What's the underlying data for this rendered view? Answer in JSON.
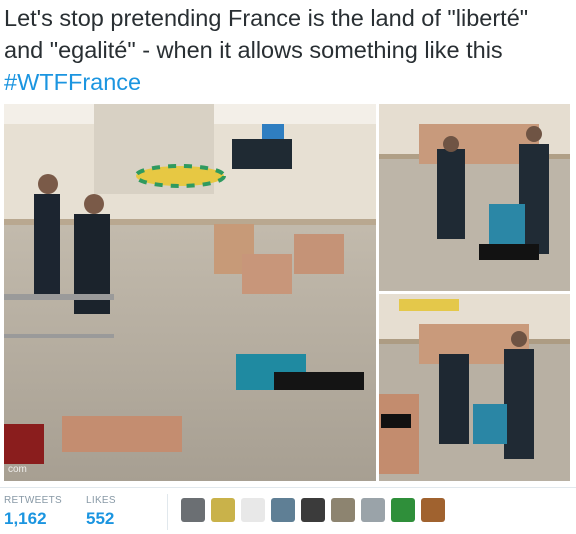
{
  "tweet": {
    "text_main": "Let's stop pretending France is the land of \"liberté\" and \"egalité\" - when it allows something like this ",
    "hashtag": "#WTFFrance"
  },
  "media": {
    "watermark": "com",
    "photos": [
      {
        "label": "beach-photo-large"
      },
      {
        "label": "beach-photo-top-right"
      },
      {
        "label": "beach-photo-bottom-right"
      }
    ]
  },
  "stats": {
    "retweets_label": "RETWEETS",
    "retweets_count": "1,162",
    "likes_label": "LIKES",
    "likes_count": "552"
  },
  "likers": {
    "avatars": [
      {
        "name": "liker-avatar-1",
        "color": "#6b6f73"
      },
      {
        "name": "liker-avatar-2",
        "color": "#c9b24a"
      },
      {
        "name": "liker-avatar-3",
        "color": "#e8e8e8"
      },
      {
        "name": "liker-avatar-4",
        "color": "#5f7f95"
      },
      {
        "name": "liker-avatar-5",
        "color": "#3b3b3b"
      },
      {
        "name": "liker-avatar-6",
        "color": "#8d8470"
      },
      {
        "name": "liker-avatar-7",
        "color": "#9aa3a9"
      },
      {
        "name": "liker-avatar-8",
        "color": "#2f8f3a"
      },
      {
        "name": "liker-avatar-9",
        "color": "#a0622f"
      }
    ]
  },
  "colors": {
    "link": "#1b95e0",
    "text": "#292f33",
    "muted": "#8899a6"
  }
}
